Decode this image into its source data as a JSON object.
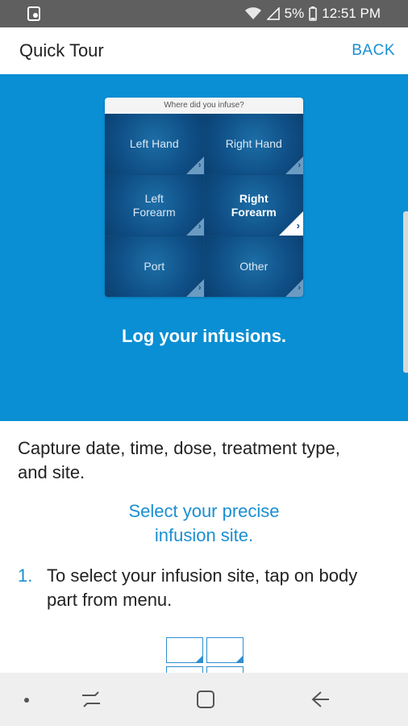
{
  "status_bar": {
    "battery": "5%",
    "time": "12:51 PM",
    "icons": [
      "notification-icon",
      "wifi-icon",
      "signal-icon",
      "battery-icon"
    ]
  },
  "header": {
    "title": "Quick Tour",
    "back_label": "BACK"
  },
  "mock": {
    "question": "Where did you infuse?",
    "cells": [
      {
        "label": "Left Hand",
        "selected": false
      },
      {
        "label": "Right Hand",
        "selected": false
      },
      {
        "label": "Left\nForearm",
        "selected": false
      },
      {
        "label": "Right\nForearm",
        "selected": true
      },
      {
        "label": "Port",
        "selected": false
      },
      {
        "label": "Other",
        "selected": false
      }
    ]
  },
  "hero": {
    "caption": "Log your infusions."
  },
  "content": {
    "description": "Capture date, time, dose, treatment type, and site.",
    "highlight": "Select your precise infusion site.",
    "steps": [
      {
        "number": "1.",
        "text": "To select your infusion site, tap on body part from menu."
      }
    ]
  },
  "nav": {
    "icons": [
      "dot-icon",
      "recent-apps-icon",
      "home-icon",
      "back-arrow-icon"
    ]
  },
  "colors": {
    "hero_blue": "#0a8fd4",
    "accent_blue": "#1a8fd1",
    "status_bar": "#5f5f5f"
  }
}
